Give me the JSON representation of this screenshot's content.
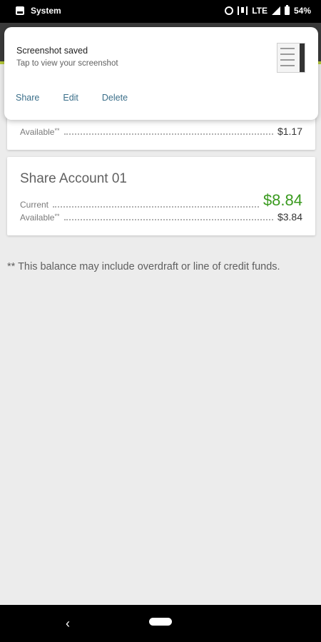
{
  "status_bar": {
    "app_label": "System",
    "network": "LTE",
    "battery": "54%"
  },
  "cards": [
    {
      "available_label": "Available",
      "available_marker": "**",
      "available_value": "$1.17"
    },
    {
      "title": "Share Account 01",
      "current_label": "Current",
      "current_value": "$8.84",
      "available_label": "Available",
      "available_marker": "**",
      "available_value": "$3.84"
    }
  ],
  "footnote": {
    "marker": "**",
    "text": " This balance may include overdraft or line of credit funds."
  },
  "notification": {
    "title": "Screenshot saved",
    "subtitle": "Tap to view your screenshot",
    "actions": [
      "Share",
      "Edit",
      "Delete"
    ]
  },
  "colors": {
    "accent": "#b6c93a",
    "amount_green": "#3a9a1f",
    "action_link": "#3b6f8a"
  },
  "icons": {
    "status": [
      "image-icon",
      "alarm-icon",
      "vibrate-icon",
      "signal-icon",
      "battery-icon"
    ],
    "nav": [
      "back-icon",
      "home-icon"
    ]
  }
}
